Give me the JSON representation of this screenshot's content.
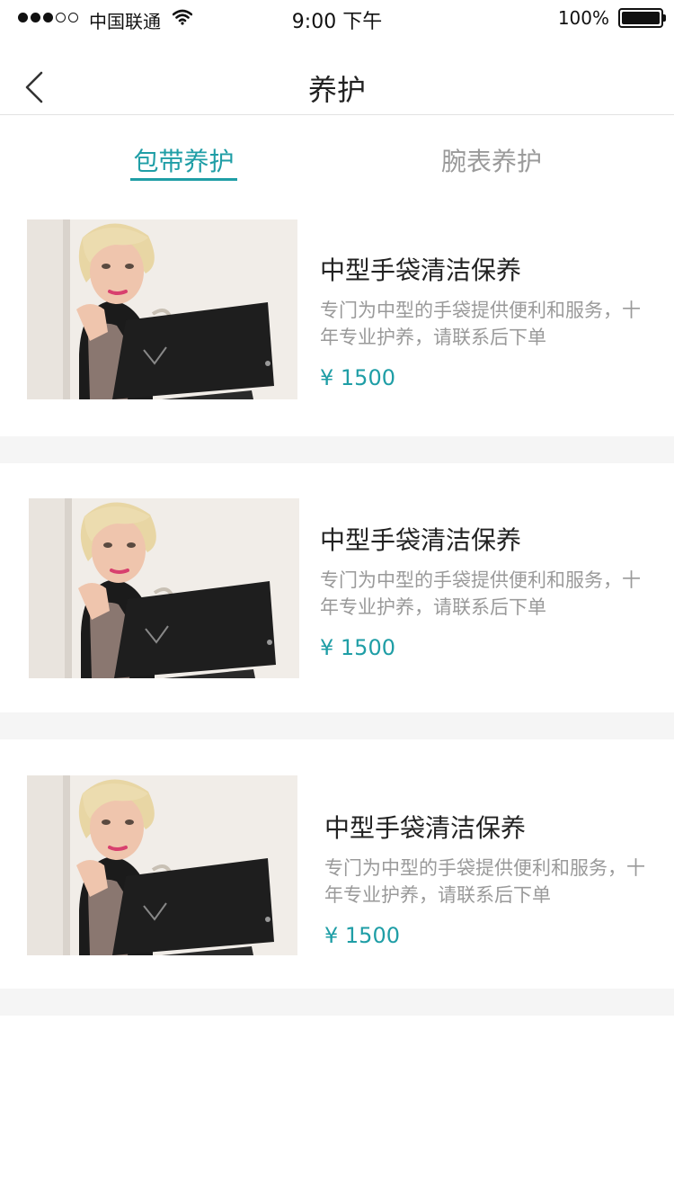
{
  "status_bar": {
    "carrier": "中国联通",
    "time": "9:00 下午",
    "battery": "100%"
  },
  "nav": {
    "title": "养护",
    "back_icon": "chevron-left-icon"
  },
  "tabs": [
    {
      "label": "包带养护",
      "active": true
    },
    {
      "label": "腕表养护",
      "active": false
    }
  ],
  "colors": {
    "accent": "#1f9ea6",
    "text_primary": "#222222",
    "text_secondary": "#9a9a9a",
    "divider": "#f5f5f5"
  },
  "items": [
    {
      "title": "中型手袋清洁保养",
      "desc": "专门为中型的手袋提供便利和服务，十年专业护养，请联系后下单",
      "price": "¥ 1500"
    },
    {
      "title": "中型手袋清洁保养",
      "desc": "专门为中型的手袋提供便利和服务，十年专业护养，请联系后下单",
      "price": "¥ 1500"
    },
    {
      "title": "中型手袋清洁保养",
      "desc": "专门为中型的手袋提供便利和服务，十年专业护养，请联系后下单",
      "price": "¥ 1500"
    }
  ]
}
